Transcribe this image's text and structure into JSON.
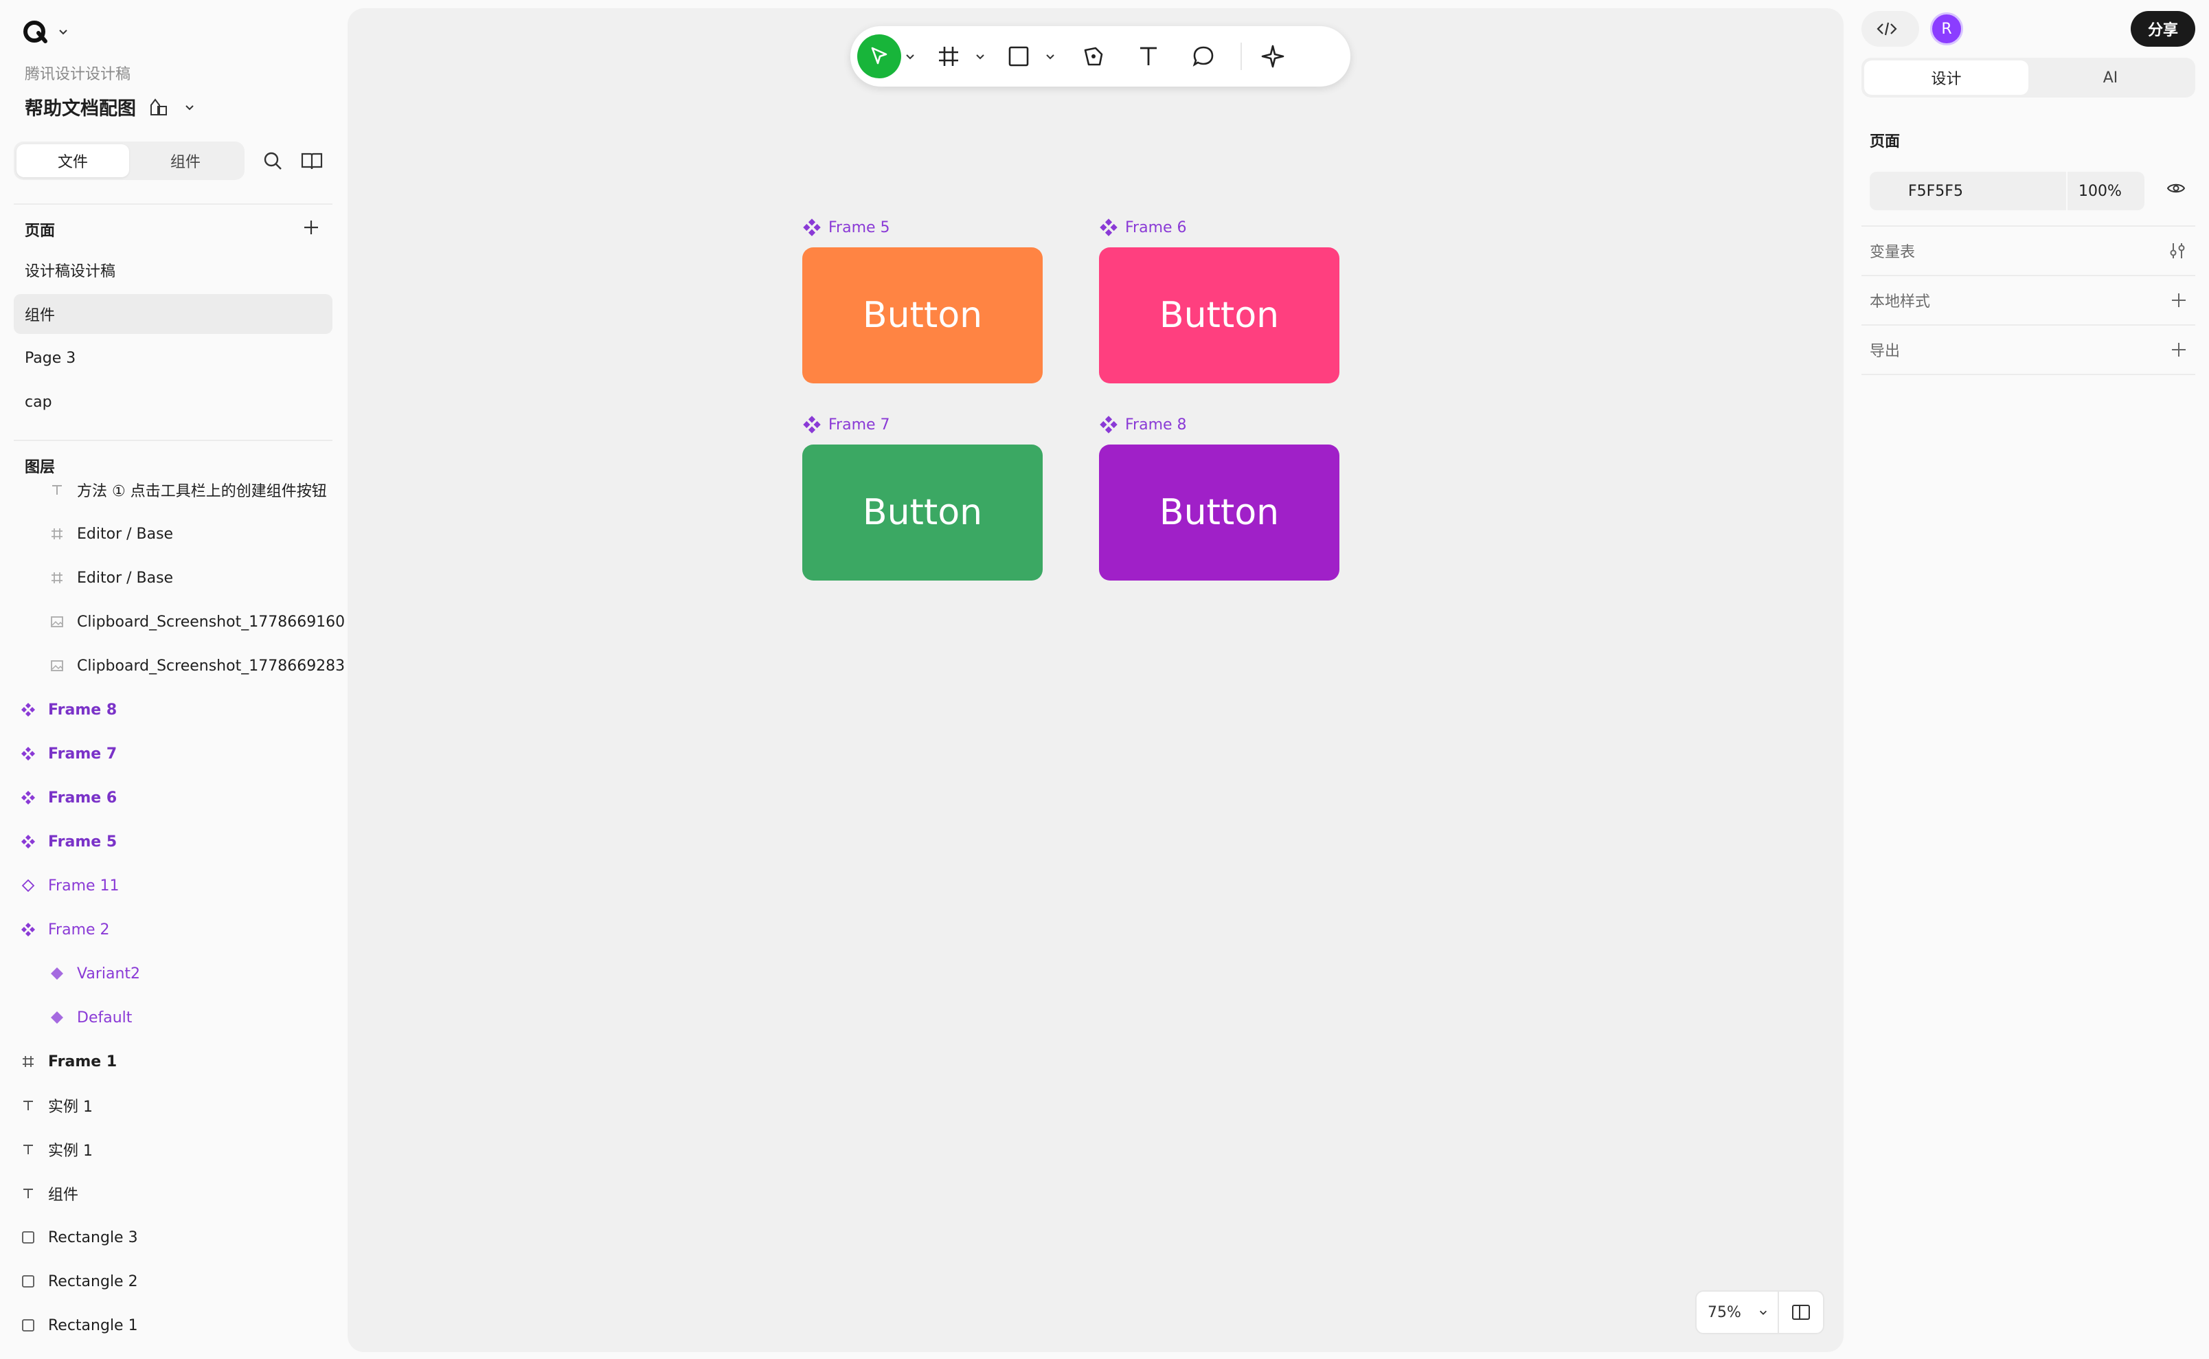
{
  "app": {
    "team_name": "腾讯设计设计稿",
    "file_title": "帮助文档配图"
  },
  "left_tabs": {
    "files": "文件",
    "components": "组件"
  },
  "pages": {
    "heading": "页面",
    "items": [
      {
        "label": "设计稿设计稿"
      },
      {
        "label": "组件"
      },
      {
        "label": "Page 3"
      },
      {
        "label": "cap"
      }
    ]
  },
  "layers": {
    "heading": "图层",
    "items": [
      {
        "label": "方法 ① 点击工具栏上的创建组件按钮",
        "icon": "text-icon"
      },
      {
        "label": "Editor / Base",
        "icon": "frame-icon"
      },
      {
        "label": "Editor / Base",
        "icon": "frame-icon"
      },
      {
        "label": "Clipboard_Screenshot_1778669160",
        "icon": "image-icon"
      },
      {
        "label": "Clipboard_Screenshot_1778669283",
        "icon": "image-icon"
      },
      {
        "label": "Frame 8",
        "icon": "component-icon"
      },
      {
        "label": "Frame 7",
        "icon": "component-icon"
      },
      {
        "label": "Frame 6",
        "icon": "component-icon"
      },
      {
        "label": "Frame 5",
        "icon": "component-icon"
      },
      {
        "label": "Frame 11",
        "icon": "instance-icon"
      },
      {
        "label": "Frame 2",
        "icon": "component-icon"
      },
      {
        "label": "Variant2",
        "icon": "variant-icon"
      },
      {
        "label": "Default",
        "icon": "variant-icon"
      },
      {
        "label": "Frame 1",
        "icon": "frame-icon"
      },
      {
        "label": "实例 1",
        "icon": "text-icon"
      },
      {
        "label": "实例 1",
        "icon": "text-icon"
      },
      {
        "label": "组件",
        "icon": "text-icon"
      },
      {
        "label": "Rectangle 3",
        "icon": "rectangle-icon"
      },
      {
        "label": "Rectangle 2",
        "icon": "rectangle-icon"
      },
      {
        "label": "Rectangle 1",
        "icon": "rectangle-icon"
      }
    ]
  },
  "canvas": {
    "frames": [
      {
        "name": "Frame 5",
        "button": "Button",
        "color": "#ff8443"
      },
      {
        "name": "Frame 6",
        "button": "Button",
        "color": "#ff3f7f"
      },
      {
        "name": "Frame 7",
        "button": "Button",
        "color": "#3ba863"
      },
      {
        "name": "Frame 8",
        "button": "Button",
        "color": "#a020c8"
      }
    ],
    "zoom": "75%",
    "background": "#f0f0f0"
  },
  "right_panel": {
    "avatar_initial": "R",
    "share_label": "分享",
    "tabs": {
      "design": "设计",
      "ai": "AI"
    },
    "page_heading": "页面",
    "page_bg_hex": "F5F5F5",
    "page_bg_opacity": "100%",
    "rows": [
      {
        "label": "变量表"
      },
      {
        "label": "本地样式"
      },
      {
        "label": "导出"
      }
    ]
  },
  "colors": {
    "accent_green": "#18b53a",
    "component_purple": "#8a3ad6",
    "avatar_purple": "#8b3dff"
  }
}
